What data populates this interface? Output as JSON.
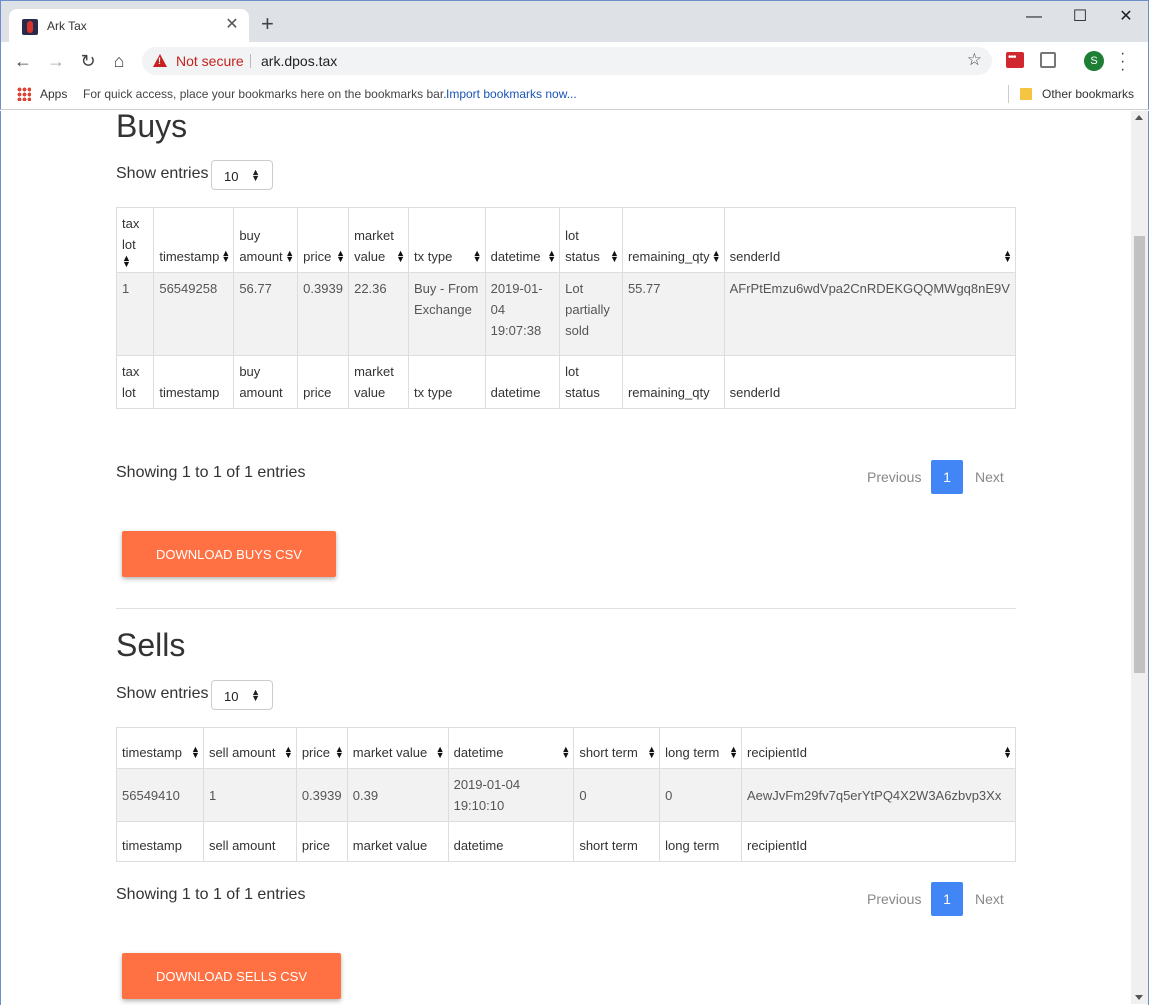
{
  "browser": {
    "tab_title": "Ark Tax",
    "new_tab": "+",
    "security_label": "Not secure",
    "url": "ark.dpos.tax",
    "profile_initial": "S",
    "bookmarks": {
      "apps": "Apps",
      "hint": "For quick access, place your bookmarks here on the bookmarks bar.",
      "import_link": "Import bookmarks now...",
      "other": "Other bookmarks"
    }
  },
  "buys": {
    "title": "Buys",
    "show_entries_label": "Show entries",
    "entries_value": "10",
    "columns": [
      "tax lot",
      "timestamp",
      "buy amount",
      "price",
      "market value",
      "tx type",
      "datetime",
      "lot status",
      "remaining_qty",
      "senderId"
    ],
    "rows": [
      {
        "tax_lot": "1",
        "timestamp": "56549258",
        "buy_amount": "56.77",
        "price": "0.3939",
        "market_value": "22.36",
        "tx_type": "Buy - From Exchange",
        "datetime": "2019-01-04 19:07:38",
        "lot_status": "Lot partially sold",
        "remaining_qty": "55.77",
        "sender_id": "AFrPtEmzu6wdVpa2CnRDEKGQQMWgq8nE9V"
      }
    ],
    "showing": "Showing 1 to 1 of 1 entries",
    "download_label": "DOWNLOAD BUYS CSV"
  },
  "sells": {
    "title": "Sells",
    "show_entries_label": "Show entries",
    "entries_value": "10",
    "columns": [
      "timestamp",
      "sell amount",
      "price",
      "market value",
      "datetime",
      "short term",
      "long term",
      "recipientId"
    ],
    "rows": [
      {
        "timestamp": "56549410",
        "sell_amount": "1",
        "price": "0.3939",
        "market_value": "0.39",
        "datetime": "2019-01-04 19:10:10",
        "short_term": "0",
        "long_term": "0",
        "recipient_id": "AewJvFm29fv7q5erYtPQ4X2W3A6zbvp3Xx"
      }
    ],
    "showing": "Showing 1 to 1 of 1 entries",
    "download_label": "DOWNLOAD SELLS CSV"
  },
  "pagination": {
    "previous": "Previous",
    "current_page": "1",
    "next": "Next"
  },
  "colors": {
    "accent_button": "#ff7043",
    "page_active": "#4285f4",
    "security_warning": "#c5221f"
  }
}
